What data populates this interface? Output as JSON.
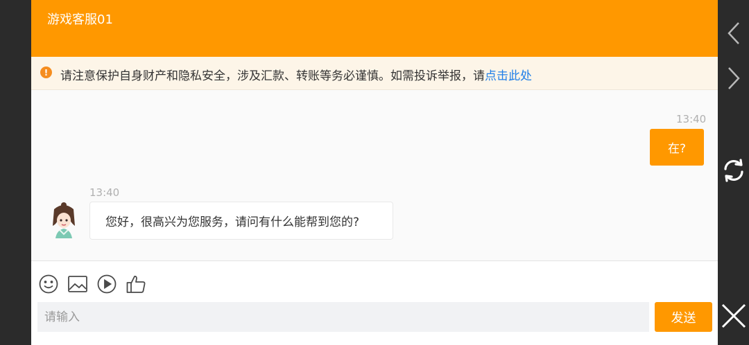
{
  "header": {
    "title": "游戏客服01"
  },
  "notice": {
    "icon": "exclamation-circle-icon",
    "text": "请注意保护自身财产和隐私安全，涉及汇款、转账等务必谨慎。如需投诉举报，请",
    "link_text": "点击此处"
  },
  "messages": {
    "outgoing": {
      "time": "13:40",
      "text": "在?"
    },
    "incoming": {
      "time": "13:40",
      "text": "您好，很高兴为您服务，请问有什么能帮到您的?",
      "avatar": "agent-avatar"
    }
  },
  "toolbar": {
    "icons": [
      "emoji-icon",
      "image-icon",
      "video-play-icon",
      "thumbs-up-icon"
    ]
  },
  "composer": {
    "placeholder": "请输入",
    "send_label": "发送"
  },
  "rail": {
    "icons": [
      "chevron-left-icon",
      "chevron-right-icon",
      "refresh-icon",
      "close-icon"
    ]
  },
  "colors": {
    "accent": "#ff9800",
    "link": "#1f7fe8",
    "notice_bg": "#fdf5e8"
  }
}
